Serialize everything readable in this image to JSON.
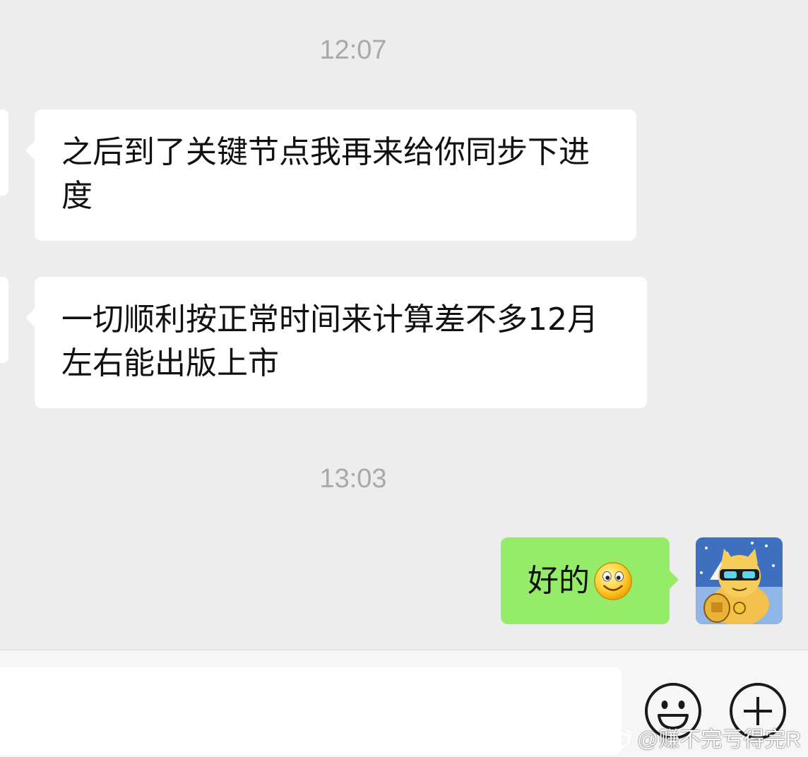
{
  "chat": {
    "timestamps": [
      "12:07",
      "13:03"
    ],
    "messages": [
      {
        "direction": "incoming",
        "text": "之后到了关键节点我再来给你同步下进度"
      },
      {
        "direction": "incoming",
        "text": " 一切顺利按正常时间来计算差不多12月左右能出版上市"
      },
      {
        "direction": "outgoing",
        "text": "好的",
        "emoji": "smiley-emoji"
      }
    ]
  },
  "input_bar": {
    "input_value": "",
    "emoji_button_icon": "smiley-face-icon",
    "plus_button_icon": "plus-circle-icon"
  },
  "watermark": {
    "text": "@赚不完亏得完R",
    "icon": "weibo-logo-icon"
  },
  "colors": {
    "background": "#ededed",
    "incoming_bubble": "#ffffff",
    "outgoing_bubble": "#95ec69",
    "timestamp": "#a9a9a9"
  }
}
